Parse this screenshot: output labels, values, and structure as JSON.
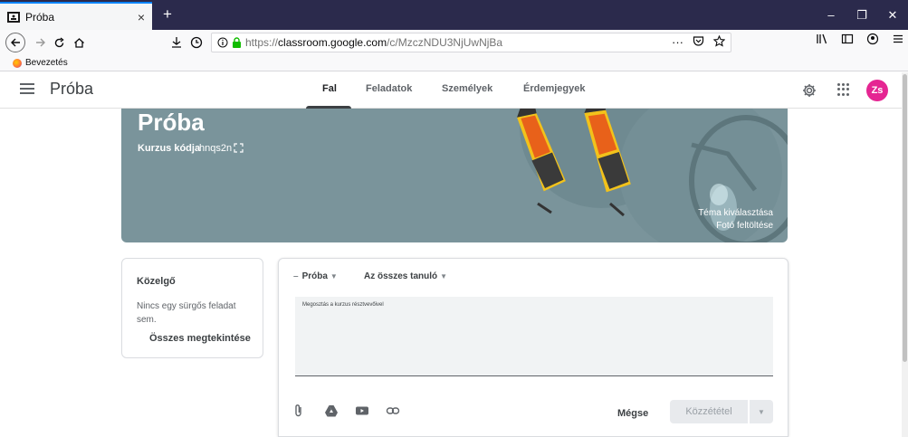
{
  "browser": {
    "tab_title": "Próba",
    "tab_close": "×",
    "new_tab": "+",
    "window_controls": [
      "–",
      "❐",
      "✕"
    ],
    "url_prefix": "https://",
    "url_host": "classroom.google.com",
    "url_path": "/c/MzczNDU3NjUwNjBa",
    "bookmark": "Bevezetés",
    "url_menu": "···"
  },
  "classroom": {
    "title": "Próba",
    "tabs": [
      {
        "label": "Fal",
        "active": true
      },
      {
        "label": "Feladatok",
        "active": false
      },
      {
        "label": "Személyek",
        "active": false
      },
      {
        "label": "Érdemjegyek",
        "active": false
      }
    ],
    "avatar": "Zs"
  },
  "banner": {
    "title": "Próba",
    "code_label": "Kurzus kódja",
    "code_value": "hnqs2n",
    "theme_link": "Téma kiválasztása",
    "upload_link": "Fotó feltöltése",
    "color": "#7a949b"
  },
  "upcoming": {
    "title": "Közelgő",
    "text": "Nincs egy sürgős feladat sem.",
    "link": "Összes megtekintése"
  },
  "composer": {
    "class_dropdown": "Próba",
    "students_dropdown": "Az összes tanuló",
    "placeholder": "Megosztás a kurzus résztvevőivel",
    "cancel": "Mégse",
    "post": "Közzététel"
  },
  "colors": {
    "accent": "#0a84ff",
    "avatar": "#e52592",
    "tab_bar": "#2b2a4c"
  }
}
